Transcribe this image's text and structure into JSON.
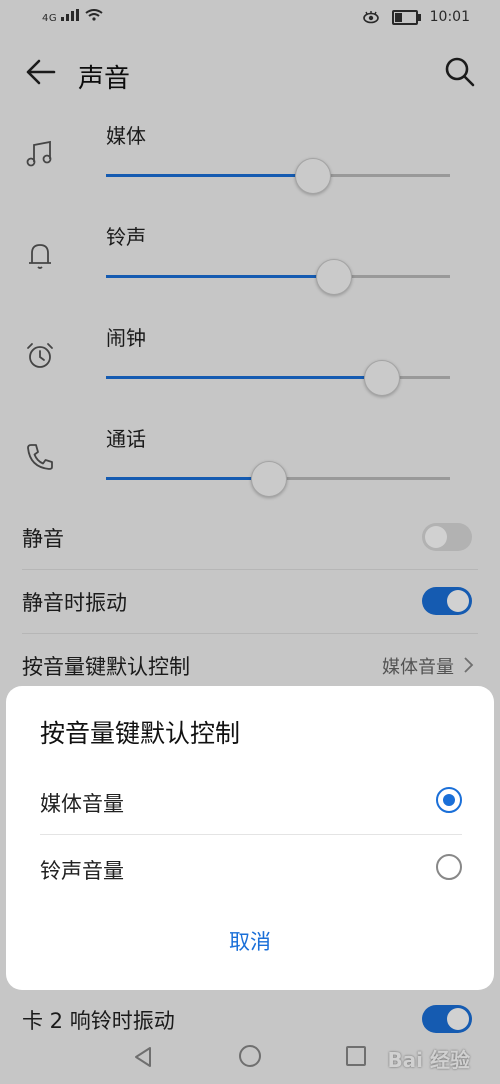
{
  "status": {
    "signal": "4G",
    "time": "10:01"
  },
  "appbar": {
    "title": "声音"
  },
  "volumes": [
    {
      "label": "媒体",
      "icon": "music-note-icon",
      "level": 0.6
    },
    {
      "label": "铃声",
      "icon": "bell-icon",
      "level": 0.66
    },
    {
      "label": "闹钟",
      "icon": "alarm-clock-icon",
      "level": 0.8
    },
    {
      "label": "通话",
      "icon": "phone-icon",
      "level": 0.47
    }
  ],
  "settings": {
    "mute": {
      "label": "静音",
      "on": false
    },
    "vibrate_on_mute": {
      "label": "静音时振动",
      "on": true
    },
    "volume_key": {
      "label": "按音量键默认控制",
      "value": "媒体音量"
    },
    "card2_vibrate": {
      "label": "卡 2 响铃时振动",
      "on": true
    }
  },
  "dialog": {
    "title": "按音量键默认控制",
    "options": [
      {
        "label": "媒体音量",
        "selected": true
      },
      {
        "label": "铃声音量",
        "selected": false
      }
    ],
    "cancel": "取消"
  },
  "watermark": "Bai 经验",
  "colors": {
    "accent": "#1a6fd8",
    "background": "#f2f2f2"
  }
}
